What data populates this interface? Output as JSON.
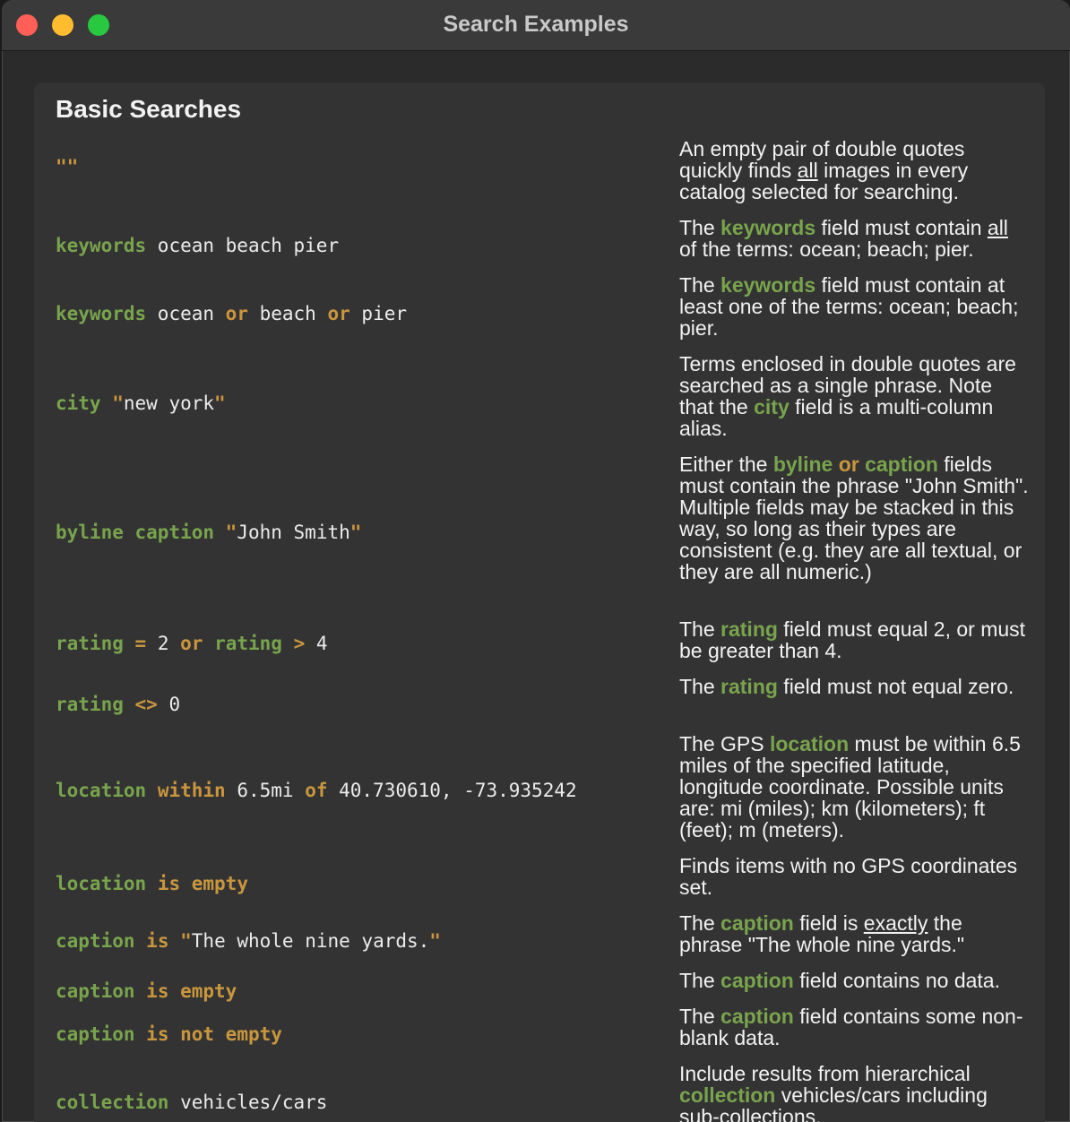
{
  "window": {
    "title": "Search Examples"
  },
  "section": {
    "title": "Basic Searches"
  },
  "examples": [
    {
      "code": [
        [
          "o",
          "\"\""
        ]
      ],
      "desc": [
        [
          "t",
          "An empty pair of double quotes quickly finds "
        ],
        [
          "u",
          "all"
        ],
        [
          "t",
          " images in every catalog selected for searching."
        ]
      ]
    },
    {
      "code": [
        [
          "f",
          "keywords"
        ],
        [
          "t",
          " ocean beach pier"
        ]
      ],
      "desc": [
        [
          "t",
          "The "
        ],
        [
          "f",
          "keywords"
        ],
        [
          "t",
          " field must contain "
        ],
        [
          "u",
          "all"
        ],
        [
          "t",
          " of the terms: ocean; beach; pier."
        ]
      ]
    },
    {
      "code": [
        [
          "f",
          "keywords"
        ],
        [
          "t",
          " ocean "
        ],
        [
          "o",
          "or"
        ],
        [
          "t",
          " beach "
        ],
        [
          "o",
          "or"
        ],
        [
          "t",
          " pier"
        ]
      ],
      "desc": [
        [
          "t",
          "The "
        ],
        [
          "f",
          "keywords"
        ],
        [
          "t",
          " field must contain at least one of the terms: ocean; beach; pier."
        ]
      ]
    },
    {
      "code": [
        [
          "f",
          "city"
        ],
        [
          "t",
          " "
        ],
        [
          "o",
          "\""
        ],
        [
          "t",
          "new york"
        ],
        [
          "o",
          "\""
        ]
      ],
      "desc": [
        [
          "t",
          "Terms enclosed in double quotes are searched as a single phrase. Note that the "
        ],
        [
          "f",
          "city"
        ],
        [
          "t",
          " field is a multi-column alias."
        ]
      ]
    },
    {
      "code": [
        [
          "f",
          "byline caption"
        ],
        [
          "t",
          " "
        ],
        [
          "o",
          "\""
        ],
        [
          "t",
          "John Smith"
        ],
        [
          "o",
          "\""
        ]
      ],
      "desc": [
        [
          "t",
          "Either the "
        ],
        [
          "f",
          "byline"
        ],
        [
          "t",
          " "
        ],
        [
          "o",
          "or"
        ],
        [
          "t",
          " "
        ],
        [
          "f",
          "caption"
        ],
        [
          "t",
          " fields must contain the phrase \"John Smith\". Multiple fields may be stacked in this way, so long as their types are consistent (e.g. they are all textual, or they are all numeric.)"
        ]
      ]
    },
    {
      "code": [
        [
          "f",
          "rating"
        ],
        [
          "t",
          " "
        ],
        [
          "o",
          "="
        ],
        [
          "t",
          " 2 "
        ],
        [
          "o",
          "or"
        ],
        [
          "t",
          " "
        ],
        [
          "f",
          "rating"
        ],
        [
          "t",
          " "
        ],
        [
          "o",
          ">"
        ],
        [
          "t",
          " 4"
        ]
      ],
      "desc": [
        [
          "t",
          "The "
        ],
        [
          "f",
          "rating"
        ],
        [
          "t",
          " field must equal 2, or must be greater than 4."
        ]
      ]
    },
    {
      "code": [
        [
          "f",
          "rating"
        ],
        [
          "t",
          " "
        ],
        [
          "o",
          "<>"
        ],
        [
          "t",
          " 0"
        ]
      ],
      "desc": [
        [
          "t",
          "The "
        ],
        [
          "f",
          "rating"
        ],
        [
          "t",
          " field must not equal zero."
        ]
      ]
    },
    {
      "code": [
        [
          "f",
          "location"
        ],
        [
          "t",
          " "
        ],
        [
          "o",
          "within"
        ],
        [
          "t",
          " 6.5mi "
        ],
        [
          "o",
          "of"
        ],
        [
          "t",
          " 40.730610, -73.935242"
        ]
      ],
      "desc": [
        [
          "t",
          "The GPS "
        ],
        [
          "f",
          "location"
        ],
        [
          "t",
          " must be within 6.5 miles of the specified latitude, longitude coordinate. Possible units are: mi (miles); km (kilometers); ft (feet); m (meters)."
        ]
      ]
    },
    {
      "code": [
        [
          "f",
          "location"
        ],
        [
          "t",
          " "
        ],
        [
          "o",
          "is empty"
        ]
      ],
      "desc": [
        [
          "t",
          "Finds items with no GPS coordinates set."
        ]
      ]
    },
    {
      "code": [
        [
          "f",
          "caption"
        ],
        [
          "t",
          " "
        ],
        [
          "o",
          "is"
        ],
        [
          "t",
          " "
        ],
        [
          "o",
          "\""
        ],
        [
          "t",
          "The whole nine yards."
        ],
        [
          "o",
          "\""
        ]
      ],
      "desc": [
        [
          "t",
          "The "
        ],
        [
          "f",
          "caption"
        ],
        [
          "t",
          " field is "
        ],
        [
          "u",
          "exactly"
        ],
        [
          "t",
          " the phrase \"The whole nine yards.\""
        ]
      ]
    },
    {
      "code": [
        [
          "f",
          "caption"
        ],
        [
          "t",
          " "
        ],
        [
          "o",
          "is empty"
        ]
      ],
      "desc": [
        [
          "t",
          "The "
        ],
        [
          "f",
          "caption"
        ],
        [
          "t",
          " field contains no data."
        ]
      ]
    },
    {
      "code": [
        [
          "f",
          "caption"
        ],
        [
          "t",
          " "
        ],
        [
          "o",
          "is not empty"
        ]
      ],
      "desc": [
        [
          "t",
          "The "
        ],
        [
          "f",
          "caption"
        ],
        [
          "t",
          " field contains some non-blank data."
        ]
      ]
    },
    {
      "code": [
        [
          "f",
          "collection"
        ],
        [
          "t",
          " vehicles/cars"
        ]
      ],
      "desc": [
        [
          "t",
          "Include results from hierarchical "
        ],
        [
          "f",
          "collection"
        ],
        [
          "t",
          " vehicles/cars including sub-collections."
        ]
      ]
    }
  ]
}
